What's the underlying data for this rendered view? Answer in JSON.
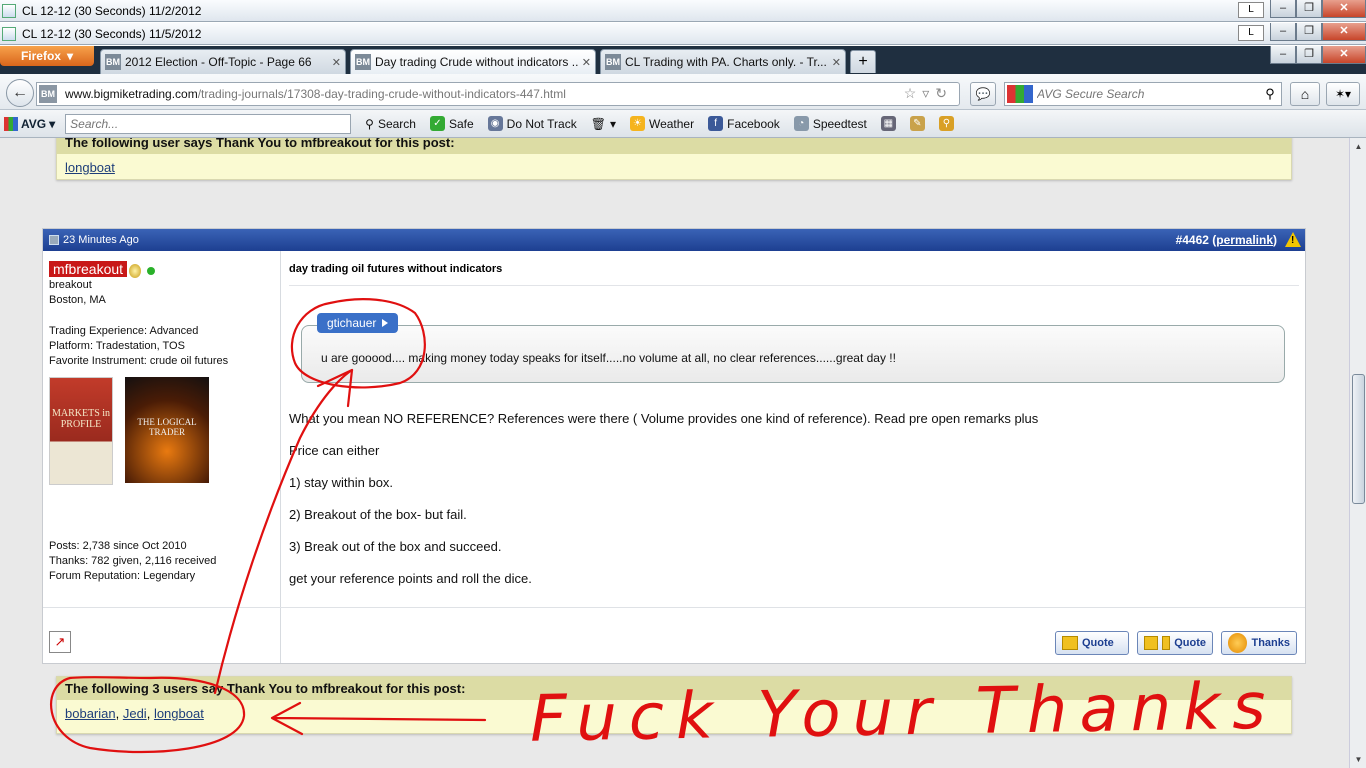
{
  "windows": [
    {
      "title": "CL 12-12 (30 Seconds)  11/2/2012",
      "lbtn": "L"
    },
    {
      "title": "CL 12-12 (30 Seconds)  11/5/2012",
      "lbtn": "L"
    }
  ],
  "firefox": {
    "button_label": "Firefox"
  },
  "tabs": [
    {
      "label": "2012 Election - Off-Topic - Page 66",
      "icon": "BM"
    },
    {
      "label": "Day trading Crude without indicators ...",
      "icon": "BM"
    },
    {
      "label": "CL Trading with PA. Charts only. - Tr...",
      "icon": "BM"
    }
  ],
  "nav": {
    "url_host": "www.bigmiketrading.com",
    "url_path": "/trading-journals/17308-day-trading-crude-without-indicators-447.html",
    "site_icon": "BM",
    "search_placeholder": "AVG Secure Search"
  },
  "avg_toolbar": {
    "logo": "AVG",
    "search_placeholder": "Search...",
    "items": [
      "Search",
      "Safe",
      "Do Not Track",
      "Weather",
      "Facebook",
      "Speedtest"
    ]
  },
  "top_thanks": {
    "header": "The following user says Thank You to mfbreakout for this post:",
    "users": [
      "longboat"
    ]
  },
  "post": {
    "time": "23 Minutes Ago",
    "number": "#4462",
    "permalink": "permalink",
    "author": {
      "name": "mfbreakout",
      "title": "breakout",
      "location": "Boston, MA",
      "experience": "Trading Experience: Advanced",
      "platform": "Platform: Tradestation, TOS",
      "instrument": "Favorite Instrument: crude oil futures",
      "book1": "MARKETS in PROFILE",
      "book2": "THE LOGICAL TRADER",
      "posts": "Posts: 2,738 since Oct 2010",
      "thanks": "Thanks: 782 given, 2,116 received",
      "reputation": "Forum Reputation: Legendary"
    },
    "title": "day trading oil futures without indicators",
    "quote": {
      "author": "gtichauer",
      "text": "u are gooood.... making money today speaks for itself.....no volume at all, no clear references......great day !!"
    },
    "body": [
      "What you mean NO REFERENCE? References were there ( Volume provides one kind of reference). Read pre open remarks plus",
      "Price can either",
      "1) stay within box.",
      "2) Breakout of the box- but fail.",
      "3) Break out of the box and succeed.",
      "get your reference points and roll the dice."
    ],
    "buttons": {
      "quote": "Quote",
      "multiquote": "Quote",
      "thanks": "Thanks"
    }
  },
  "bottom_thanks": {
    "header": "The following 3 users say Thank You to mfbreakout for this post:",
    "users": [
      "bobarian",
      "Jedi",
      "longboat"
    ]
  },
  "annotation": {
    "text": "Fuck Your Thanks",
    "color": "#e01010"
  }
}
